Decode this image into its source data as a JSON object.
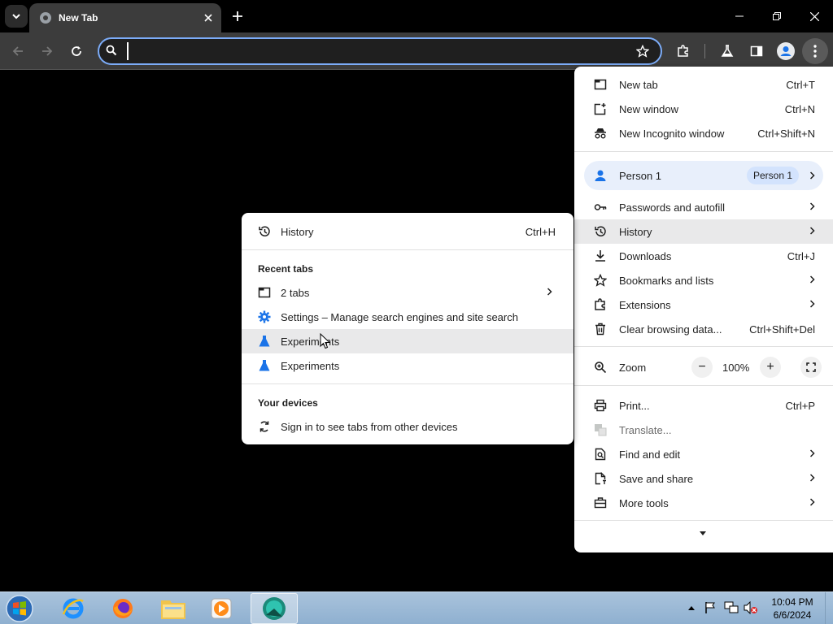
{
  "browser": {
    "tab_title": "New Tab",
    "address_value": "",
    "icons": {
      "tab_search": "chevron-down-icon",
      "tab_close": "close-icon",
      "new_tab": "plus-icon",
      "back": "back-arrow-icon",
      "forward": "forward-arrow-icon",
      "reload": "reload-icon",
      "bookmark": "star-icon",
      "extensions": "puzzle-icon",
      "labs": "flask-icon",
      "side_panel": "side-panel-icon",
      "profile": "profile-icon",
      "menu": "kebab-menu-icon"
    }
  },
  "menu": {
    "new_tab": {
      "label": "New tab",
      "shortcut": "Ctrl+T"
    },
    "new_window": {
      "label": "New window",
      "shortcut": "Ctrl+N"
    },
    "new_incognito": {
      "label": "New Incognito window",
      "shortcut": "Ctrl+Shift+N"
    },
    "person": {
      "label": "Person 1",
      "badge": "Person 1"
    },
    "passwords": {
      "label": "Passwords and autofill"
    },
    "history": {
      "label": "History"
    },
    "downloads": {
      "label": "Downloads",
      "shortcut": "Ctrl+J"
    },
    "bookmarks": {
      "label": "Bookmarks and lists"
    },
    "extensions": {
      "label": "Extensions"
    },
    "clear": {
      "label": "Clear browsing data...",
      "shortcut": "Ctrl+Shift+Del"
    },
    "zoom": {
      "label": "Zoom",
      "minus": "−",
      "value": "100%",
      "plus": "+"
    },
    "print": {
      "label": "Print...",
      "shortcut": "Ctrl+P"
    },
    "translate": {
      "label": "Translate..."
    },
    "find": {
      "label": "Find and edit"
    },
    "save": {
      "label": "Save and share"
    },
    "more_tools": {
      "label": "More tools"
    }
  },
  "history_submenu": {
    "history": {
      "label": "History",
      "shortcut": "Ctrl+H"
    },
    "recent_tabs_heading": "Recent tabs",
    "recent": [
      {
        "label": "2 tabs"
      },
      {
        "label": "Settings – Manage search engines and site search"
      },
      {
        "label": "Experiments"
      },
      {
        "label": "Experiments"
      }
    ],
    "your_devices_heading": "Your devices",
    "sign_in": {
      "label": "Sign in to see tabs from other devices"
    }
  },
  "taskbar": {
    "time": "10:04 PM",
    "date": "6/6/2024",
    "apps": [
      "internet-explorer-icon",
      "firefox-icon",
      "file-explorer-icon",
      "media-player-icon",
      "app-icon"
    ]
  }
}
